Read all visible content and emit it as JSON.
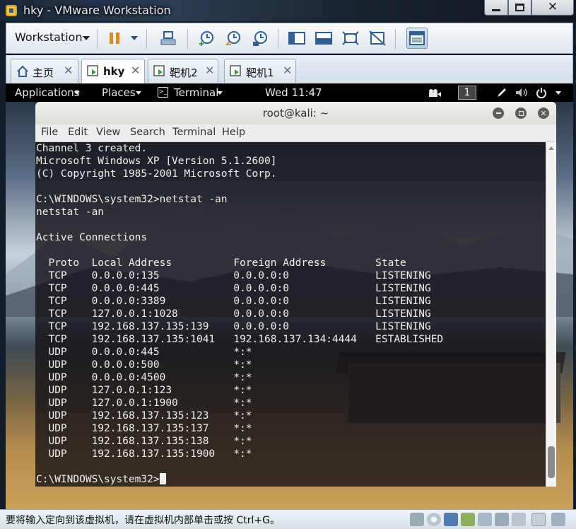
{
  "vmware": {
    "title": "hky - VMware Workstation",
    "colors": {
      "accent": "#e08a1e",
      "toolbar_bg": "#dfe6ee",
      "status_bg": "#d8e0e8"
    },
    "toolbar": {
      "menu_label": "Workstation",
      "icons": [
        "pause-icon",
        "dropdown-icon",
        "send-ctrl-alt-del-icon",
        "snapshot-take-icon",
        "snapshot-revert-icon",
        "snapshot-manager-icon",
        "library-view-icon",
        "console-view-icon",
        "fullscreen-icon",
        "unity-icon",
        "thumbnail-view-icon"
      ]
    },
    "tabs": [
      {
        "label": "主页",
        "icon": "home-icon"
      },
      {
        "label": "hky",
        "icon": "vm-icon",
        "active": true
      },
      {
        "label": "靶机2",
        "icon": "vm-icon"
      },
      {
        "label": "靶机1",
        "icon": "vm-icon"
      }
    ],
    "status_text": "要将输入定向到该虚拟机，请在虚拟机内部单击或按 Ctrl+G。"
  },
  "gnome": {
    "applications": "Applications",
    "places": "Places",
    "terminal": "Terminal",
    "clock": "Wed 11:47",
    "workspace": "1"
  },
  "terminal": {
    "title": "root@kali: ~",
    "menu": [
      "File",
      "Edit",
      "View",
      "Search",
      "Terminal",
      "Help"
    ],
    "lines": [
      "Channel 3 created.",
      "Microsoft Windows XP [Version 5.1.2600]",
      "(C) Copyright 1985-2001 Microsoft Corp.",
      "",
      "C:\\WINDOWS\\system32>netstat -an",
      "netstat -an",
      "",
      "Active Connections",
      "",
      "  Proto  Local Address          Foreign Address        State",
      "  TCP    0.0.0.0:135            0.0.0.0:0              LISTENING",
      "  TCP    0.0.0.0:445            0.0.0.0:0              LISTENING",
      "  TCP    0.0.0.0:3389           0.0.0.0:0              LISTENING",
      "  TCP    127.0.0.1:1028         0.0.0.0:0              LISTENING",
      "  TCP    192.168.137.135:139    0.0.0.0:0              LISTENING",
      "  TCP    192.168.137.135:1041   192.168.137.134:4444   ESTABLISHED",
      "  UDP    0.0.0.0:445            *:*",
      "  UDP    0.0.0.0:500            *:*",
      "  UDP    0.0.0.0:4500           *:*",
      "  UDP    127.0.0.1:123          *:*",
      "  UDP    127.0.0.1:1900         *:*",
      "  UDP    192.168.137.135:123    *:*",
      "  UDP    192.168.137.135:137    *:*",
      "  UDP    192.168.137.135:138    *:*",
      "  UDP    192.168.137.135:1900   *:*",
      ""
    ],
    "prompt": "C:\\WINDOWS\\system32>"
  }
}
